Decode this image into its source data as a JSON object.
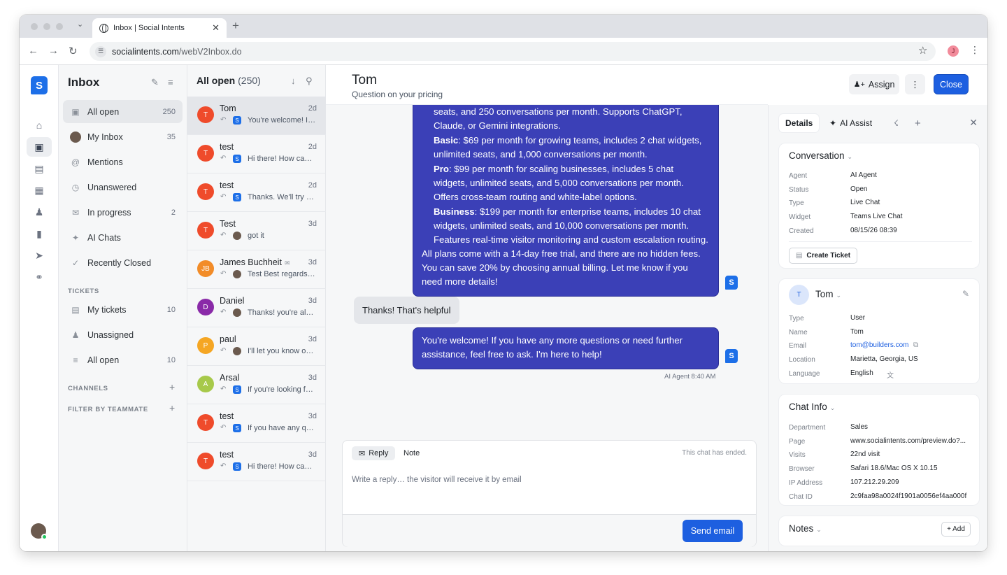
{
  "browser": {
    "tab_title": "Inbox | Social Intents",
    "url_domain": "socialintents.com",
    "url_path": "/webV2Inbox.do",
    "profile_initial": "J"
  },
  "nav": {
    "title": "Inbox",
    "items": [
      {
        "label": "All open",
        "count": "250",
        "icon": "inbox-icon"
      },
      {
        "label": "My Inbox",
        "count": "35",
        "icon": "avatar"
      },
      {
        "label": "Mentions",
        "count": "",
        "icon": "at-icon"
      },
      {
        "label": "Unanswered",
        "count": "",
        "icon": "clock-icon"
      },
      {
        "label": "In progress",
        "count": "2",
        "icon": "chat-icon"
      },
      {
        "label": "AI Chats",
        "count": "",
        "icon": "sparkle-icon"
      },
      {
        "label": "Recently Closed",
        "count": "",
        "icon": "check-circle-icon"
      }
    ],
    "tickets_section": "TICKETS",
    "ticket_items": [
      {
        "label": "My tickets",
        "count": "10",
        "icon": "ticket-icon"
      },
      {
        "label": "Unassigned",
        "count": "",
        "icon": "user-icon"
      },
      {
        "label": "All open",
        "count": "10",
        "icon": "list-icon"
      }
    ],
    "channels_section": "CHANNELS",
    "filter_section": "FILTER BY TEAMMATE"
  },
  "list": {
    "title": "All open",
    "count": "(250)",
    "conversations": [
      {
        "initial": "T",
        "name": "Tom",
        "time": "2d",
        "preview": "You're welcome! If...",
        "sender": "agent",
        "color": "#ef4b2b",
        "email": false
      },
      {
        "initial": "T",
        "name": "test",
        "time": "2d",
        "preview": "Hi there! How can I...",
        "sender": "agent",
        "color": "#ef4b2b",
        "email": false
      },
      {
        "initial": "T",
        "name": "test",
        "time": "2d",
        "preview": "Thanks. We'll try a...",
        "sender": "agent",
        "color": "#ef4b2b",
        "email": false
      },
      {
        "initial": "T",
        "name": "Test",
        "time": "3d",
        "preview": "got it",
        "sender": "human",
        "color": "#ef4b2b",
        "email": false
      },
      {
        "initial": "JB",
        "name": "James Buchheit",
        "time": "3d",
        "preview": "Test Best regards, ...",
        "sender": "human",
        "color": "#f28c28",
        "email": true
      },
      {
        "initial": "D",
        "name": "Daniel",
        "time": "3d",
        "preview": "Thanks! you're alw...",
        "sender": "human",
        "color": "#8a2aa8",
        "email": false
      },
      {
        "initial": "P",
        "name": "paul",
        "time": "3d",
        "preview": "I'll let you know on...",
        "sender": "human",
        "color": "#f5a623",
        "email": false
      },
      {
        "initial": "A",
        "name": "Arsal",
        "time": "3d",
        "preview": "If you're looking fo...",
        "sender": "agent",
        "color": "#a7c94a",
        "email": false
      },
      {
        "initial": "T",
        "name": "test",
        "time": "3d",
        "preview": "If you have any qu...",
        "sender": "agent",
        "color": "#ef4b2b",
        "email": false
      },
      {
        "initial": "T",
        "name": "test",
        "time": "3d",
        "preview": "Hi there! How can I...",
        "sender": "agent",
        "color": "#ef4b2b",
        "email": false
      }
    ]
  },
  "chat": {
    "name": "Tom",
    "subtitle": "Question on your pricing",
    "assign_label": "Assign",
    "close_label": "Close",
    "pricing": {
      "intro_fragment": "seats, and 250 conversations per month. Supports ChatGPT, Claude, or Gemini integrations.",
      "basic_name": "Basic",
      "basic_text": ": $69 per month for growing teams, includes 2 chat widgets, unlimited seats, and 1,000 conversations per month.",
      "pro_name": "Pro",
      "pro_text": ": $99 per month for scaling businesses, includes 5 chat widgets, unlimited seats, and 5,000 conversations per month. Offers cross-team routing and white-label options.",
      "business_name": "Business",
      "business_text": ": $199 per month for enterprise teams, includes 10 chat widgets, unlimited seats, and 10,000 conversations per month. Features real-time visitor monitoring and custom escalation routing.",
      "outro": "All plans come with a 14-day free trial, and there are no hidden fees. You can save 20% by choosing annual billing. Let me know if you need more details!"
    },
    "visitor_message": "Thanks! That's helpful",
    "agent_reply": "You're welcome! If you have any more questions or need further assistance, feel free to ask. I'm here to help!",
    "agent_meta": "AI Agent  8:40 AM",
    "composer": {
      "reply_tab": "Reply",
      "note_tab": "Note",
      "ended_notice": "This chat has ended.",
      "placeholder": "Write a reply… the visitor will receive it by email",
      "send_label": "Send email"
    }
  },
  "details": {
    "tabs": [
      "Details",
      "AI Assist"
    ],
    "conversation": {
      "title": "Conversation",
      "rows": [
        {
          "k": "Agent",
          "v": "AI Agent"
        },
        {
          "k": "Status",
          "v": "Open"
        },
        {
          "k": "Type",
          "v": "Live Chat"
        },
        {
          "k": "Widget",
          "v": "Teams Live Chat"
        },
        {
          "k": "Created",
          "v": "08/15/26 08:39"
        }
      ],
      "ticket_button": "Create Ticket"
    },
    "user": {
      "initial": "T",
      "name": "Tom",
      "rows": [
        {
          "k": "Type",
          "v": "User"
        },
        {
          "k": "Name",
          "v": "Tom"
        },
        {
          "k": "Email",
          "v": "tom@builders.com"
        },
        {
          "k": "Location",
          "v": "Marietta, Georgia, US"
        },
        {
          "k": "Language",
          "v": "English"
        }
      ]
    },
    "chat_info": {
      "title": "Chat Info",
      "rows": [
        {
          "k": "Department",
          "v": "Sales"
        },
        {
          "k": "Page",
          "v": "www.socialintents.com/preview.do?..."
        },
        {
          "k": "Visits",
          "v": "22nd visit"
        },
        {
          "k": "Browser",
          "v": "Safari 18.6/Mac OS X 10.15"
        },
        {
          "k": "IP Address",
          "v": "107.212.29.209"
        },
        {
          "k": "Chat ID",
          "v": "2c9faa98a0024f1901a0056ef4aa000f"
        }
      ]
    },
    "notes": {
      "title": "Notes",
      "add_label": "+ Add"
    }
  },
  "colors": {
    "accent": "#1d5fe0",
    "agent_bubble": "#3b40b7",
    "brand": "#1d6fe8"
  }
}
